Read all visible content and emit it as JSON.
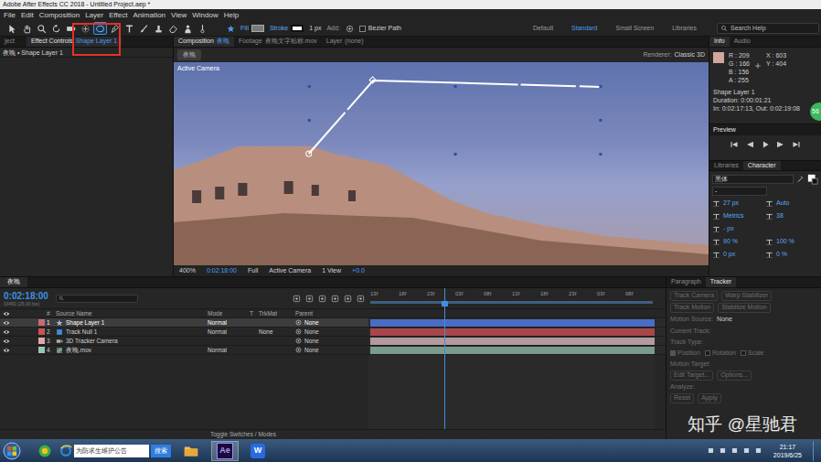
{
  "window": {
    "title": "Adobe After Effects CC 2018 - Untitled Project.aep *"
  },
  "menu": [
    "File",
    "Edit",
    "Composition",
    "Layer",
    "Effect",
    "Animation",
    "View",
    "Window",
    "Help"
  ],
  "tools": [
    {
      "kind": "selection",
      "selected": false
    },
    {
      "kind": "hand",
      "selected": false
    },
    {
      "kind": "zoom",
      "selected": false
    },
    {
      "kind": "rotate",
      "selected": false
    },
    {
      "kind": "camera",
      "selected": false
    },
    {
      "kind": "pan",
      "selected": false
    },
    {
      "kind": "ellipse",
      "selected": true
    },
    {
      "kind": "pen",
      "selected": false
    },
    {
      "kind": "text",
      "selected": false
    },
    {
      "kind": "brush",
      "selected": false
    },
    {
      "kind": "clone",
      "selected": false
    },
    {
      "kind": "eraser",
      "selected": false
    },
    {
      "kind": "roto",
      "selected": false
    },
    {
      "kind": "puppet",
      "selected": false
    }
  ],
  "shape_options": {
    "fill": "Fill",
    "stroke": "Stroke",
    "stroke_width": "1 px",
    "add": "Add:",
    "bezier": "Bezier Path"
  },
  "workspaces": [
    {
      "label": "Default",
      "selected": false
    },
    {
      "label": "Standard",
      "selected": true
    },
    {
      "label": "Small Screen",
      "selected": false
    },
    {
      "label": "Libraries",
      "selected": false
    }
  ],
  "search_help": "Search Help",
  "annotation": {
    "shown": true
  },
  "left_panel": {
    "tabs": [
      {
        "label": "ject",
        "selected": false
      },
      {
        "label": "Effect Controls",
        "sub": "Shape Layer 1",
        "selected": true
      }
    ],
    "header": "夜晚 • Shape Layer 1"
  },
  "comp_panel": {
    "tabs": [
      {
        "label": "Composition",
        "sub": "夜晚",
        "selected": true
      },
      {
        "label": "Footage",
        "sub": "夜晚文字贴标.mov",
        "selected": false
      },
      {
        "label": "Layer",
        "sub": "(none)",
        "selected": false
      }
    ],
    "comp_chip": "夜晚",
    "renderer_label": "Renderer:",
    "renderer": "Classic 3D",
    "viewer_label": "Active Camera",
    "footer": {
      "zoom": "400%",
      "time": "0:02:18:00",
      "resolution": "Full",
      "camera": "Active Camera",
      "views": "1 View",
      "exposure": "+0.0"
    }
  },
  "info": {
    "tabs": [
      {
        "label": "Info",
        "selected": true
      },
      {
        "label": "Audio",
        "selected": false
      }
    ],
    "swatch": "#d1a69c",
    "channels": [
      "R : 209",
      "G : 166",
      "B : 156",
      "A : 255"
    ],
    "coords": [
      "X : 603",
      "Y : 404"
    ],
    "lines": [
      "Shape Layer 1",
      "Duration: 0:00:01:21",
      "In: 0:02:17:13, Out: 0:02:19:08"
    ]
  },
  "badge": "56",
  "preview": {
    "title": "Preview"
  },
  "character": {
    "tabs": [
      {
        "label": "Libraries",
        "selected": false
      },
      {
        "label": "Character",
        "selected": true
      }
    ],
    "font": "黑体",
    "style": "-",
    "fields": [
      [
        "27 px",
        "Auto"
      ],
      [
        "Metrics",
        "38"
      ],
      [
        "- px"
      ],
      [
        "90 %",
        "100 %"
      ],
      [
        "0 px",
        "0 %"
      ]
    ]
  },
  "timeline": {
    "tab": "夜晚",
    "time": "0:02:18:00",
    "fps": "03450 (25.00 fps)",
    "columns": [
      "#",
      "Source Name",
      "Mode",
      "T",
      "TrkMat",
      "Parent"
    ],
    "ruler": [
      "13f",
      "18f",
      "23f",
      "03f",
      "08f",
      "13f",
      "18f",
      "23f",
      "03f",
      "08f"
    ],
    "playhead": 0.26,
    "layers": [
      {
        "num": "1",
        "name": "Shape Layer 1",
        "kind": "shape",
        "mode": "Normal",
        "parent": "None",
        "selected": true,
        "visible": true,
        "label_color": "#c76b78",
        "bar_color": "#4a6cc4"
      },
      {
        "num": "2",
        "name": "Track Null 1",
        "kind": "null",
        "mode": "Normal",
        "trkmat": "None",
        "parent": "None",
        "selected": false,
        "visible": true,
        "label_color": "#c9544f",
        "bar_color": "#a8474a"
      },
      {
        "num": "3",
        "name": "3D Tracker Camera",
        "kind": "camera",
        "parent": "None",
        "selected": false,
        "visible": true,
        "label_color": "#e0a8a8",
        "bar_color": "#b39a9d"
      },
      {
        "num": "4",
        "name": "夜晚.mov",
        "kind": "footage",
        "mode": "Normal",
        "parent": "None",
        "selected": false,
        "visible": true,
        "label_color": "#9ec3b0",
        "bar_color": "#7b9a8e"
      }
    ],
    "toggle": "Toggle Switches / Modes"
  },
  "tracker": {
    "tabs": [
      {
        "label": "Paragraph",
        "selected": false
      },
      {
        "label": "Tracker",
        "selected": true
      }
    ],
    "disabled": true,
    "buttons": [
      "Track Camera",
      "Warp Stabilizer",
      "Track Motion",
      "Stabilize Motion"
    ],
    "source_label": "Motion Source:",
    "source": "None",
    "fields": [
      "Current Track:",
      "Track Type:"
    ],
    "checks": [
      {
        "label": "Position",
        "checked": true
      },
      {
        "label": "Rotation",
        "checked": false
      },
      {
        "label": "Scale",
        "checked": false
      }
    ],
    "target_label": "Motion Target:",
    "target_buttons": [
      "Edit Target...",
      "Options..."
    ],
    "analyze": "Analyze:",
    "final_buttons": [
      "Reset",
      "Apply"
    ]
  },
  "taskbar": {
    "search": "为防求生维护公告",
    "search_button": "搜索",
    "apps": [
      {
        "kind": "folder",
        "selected": false
      },
      {
        "kind": "ae",
        "label": "Ae",
        "selected": true
      },
      {
        "kind": "wps",
        "label": "W",
        "selected": false
      }
    ],
    "time": "21:17",
    "date": "2019/6/25"
  },
  "watermark": "知乎 @星驰君"
}
